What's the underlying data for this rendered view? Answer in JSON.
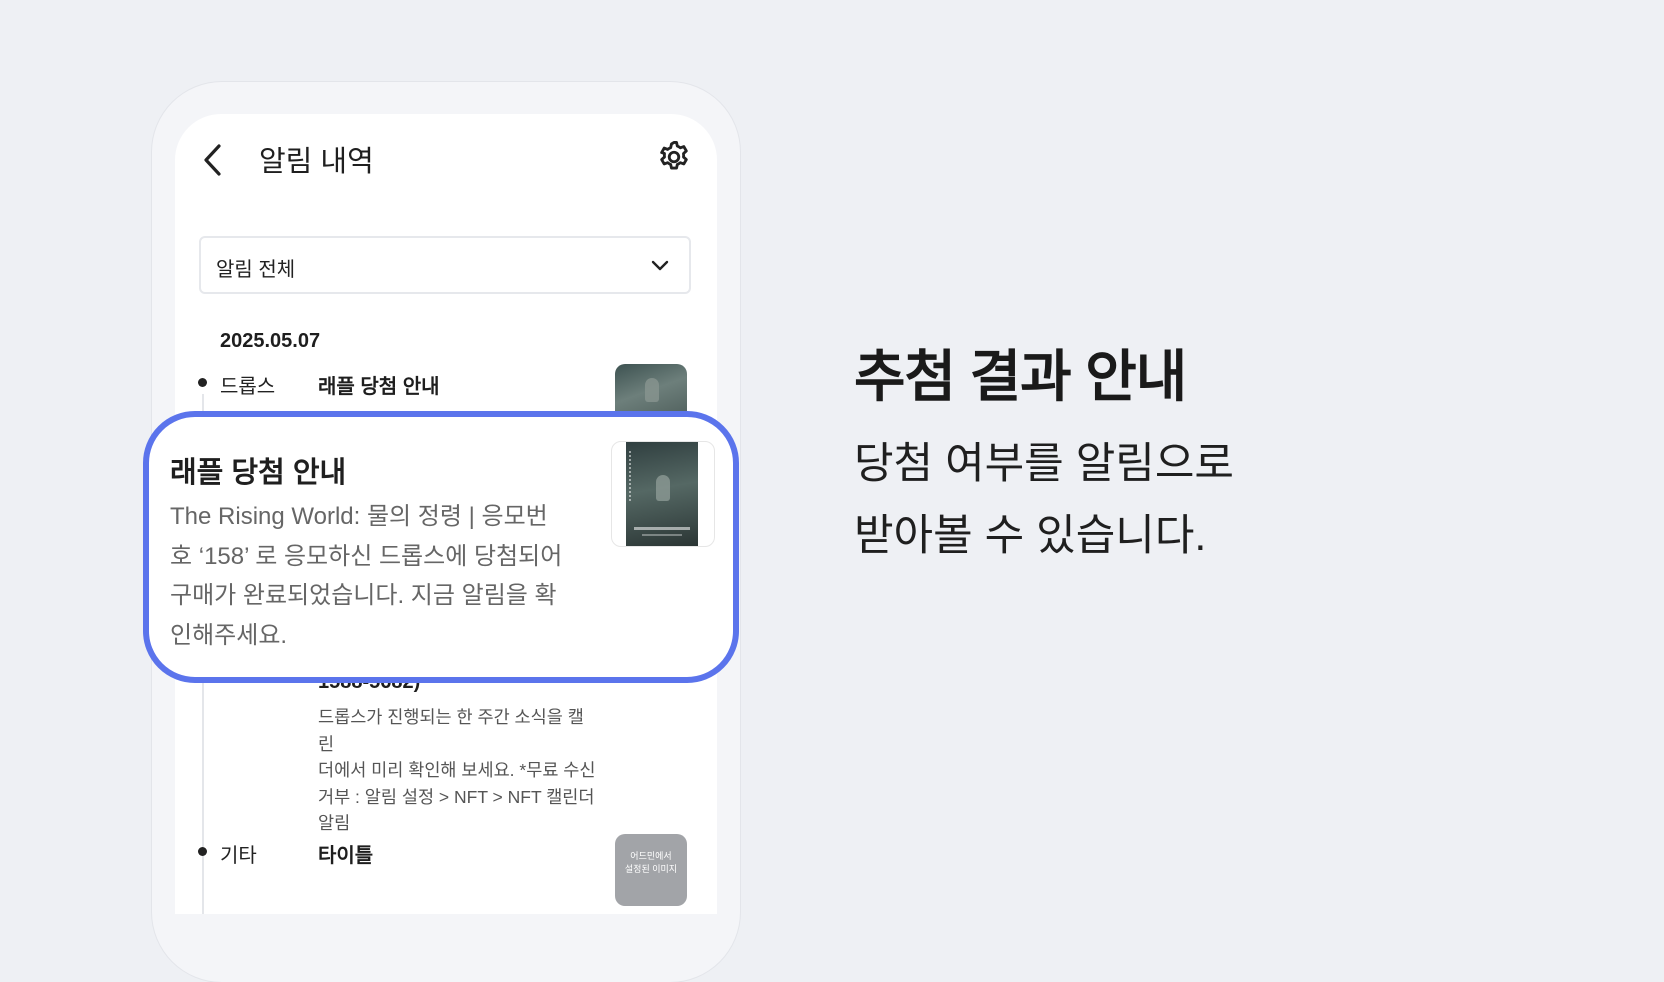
{
  "header": {
    "title": "알림 내역",
    "back_icon": "chevron-left-icon",
    "settings_icon": "gear-icon"
  },
  "filter": {
    "selected": "알림 전체",
    "icon": "chevron-down-icon"
  },
  "date": "2025.05.07",
  "items": [
    {
      "category": "드롭스",
      "title": "래플 당첨 안내"
    },
    {
      "title": "1588-5682)",
      "body": [
        "드롭스가 진행되는 한 주간 소식을 캘린",
        "더에서 미리 확인해 보세요. *무료 수신",
        "거부 : 알림 설정 > NFT > NFT 캘린더",
        "알림"
      ]
    },
    {
      "category": "기타",
      "title": "타이틀",
      "thumb_text": [
        "어드민에서",
        "설정된 이미지"
      ]
    }
  ],
  "card": {
    "title": "래플 당첨 안내",
    "body": [
      "The Rising World: 물의 정령 | 응모번",
      "호 ‘158’ 로 응모하신 드롭스에 당첨되어",
      "구매가 완료되었습니다. 지금 알림을 확",
      "인해주세요."
    ],
    "highlight_color": "#5b74ec"
  },
  "promo": {
    "headline": "추첨 결과 안내",
    "sub": [
      "당첨 여부를 알림으로",
      "받아볼 수 있습니다."
    ]
  }
}
